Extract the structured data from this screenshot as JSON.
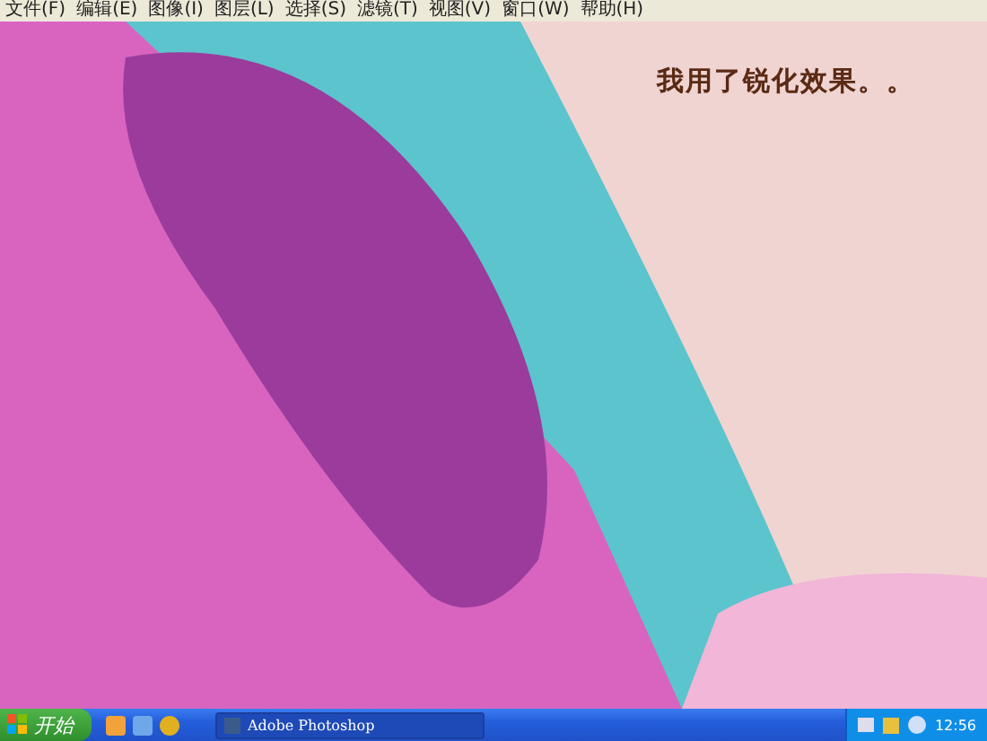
{
  "menu_bar": {
    "items": [
      "文件(F)",
      "编辑(E)",
      "图像(I)",
      "图层(L)",
      "选择(S)",
      "滤镜(T)",
      "视图(V)",
      "窗口(W)",
      "帮助(H)"
    ]
  },
  "canvas": {
    "caption": "我用了锐化效果。。"
  },
  "taskbar": {
    "start_label": "开始",
    "tasks": [
      {
        "label": "Adobe Photoshop",
        "selected": true
      }
    ],
    "clock": "12:56"
  }
}
